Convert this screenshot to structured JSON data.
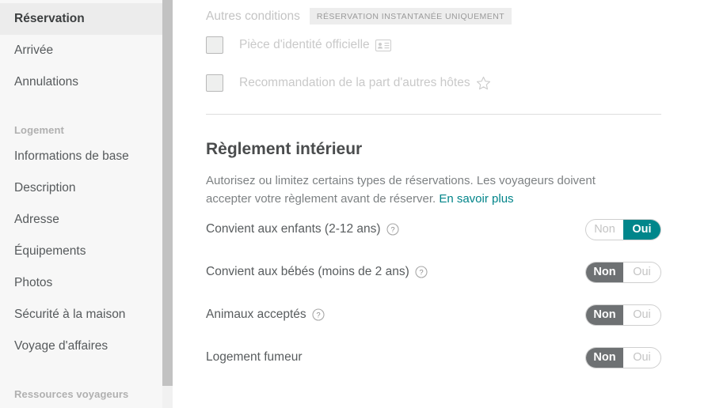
{
  "sidebar": {
    "items": [
      {
        "label": "Réservation",
        "type": "link",
        "active": true
      },
      {
        "label": "Arrivée",
        "type": "link",
        "active": false
      },
      {
        "label": "Annulations",
        "type": "link",
        "active": false
      },
      {
        "label": "Logement",
        "type": "section"
      },
      {
        "label": "Informations de base",
        "type": "link",
        "active": false
      },
      {
        "label": "Description",
        "type": "link",
        "active": false
      },
      {
        "label": "Adresse",
        "type": "link",
        "active": false
      },
      {
        "label": "Équipements",
        "type": "link",
        "active": false
      },
      {
        "label": "Photos",
        "type": "link",
        "active": false
      },
      {
        "label": "Sécurité à la maison",
        "type": "link",
        "active": false
      },
      {
        "label": "Voyage d'affaires",
        "type": "link",
        "active": false
      },
      {
        "label": "Ressources voyageurs",
        "type": "section"
      }
    ]
  },
  "other_conditions": {
    "title": "Autres conditions",
    "badge": "RÉSERVATION INSTANTANÉE UNIQUEMENT",
    "checkboxes": [
      {
        "label": "Pièce d'identité officielle",
        "icon": "id-card-icon",
        "checked": false,
        "disabled": true
      },
      {
        "label": "Recommandation de la part d'autres hôtes",
        "icon": "star-icon",
        "checked": false,
        "disabled": true
      }
    ]
  },
  "house_rules": {
    "title": "Règlement intérieur",
    "description": "Autorisez ou limitez certains types de réservations. Les voyageurs doivent accepter votre règlement avant de réserver.",
    "link_text": "En savoir plus",
    "toggle_no_label": "Non",
    "toggle_yes_label": "Oui",
    "rules": [
      {
        "label": "Convient aux enfants (2-12 ans)",
        "help": true,
        "value": "Oui"
      },
      {
        "label": "Convient aux bébés (moins de 2 ans)",
        "help": true,
        "value": "Non"
      },
      {
        "label": "Animaux acceptés",
        "help": true,
        "value": "Non"
      },
      {
        "label": "Logement fumeur",
        "help": false,
        "value": "Non"
      }
    ]
  },
  "colors": {
    "accent_teal": "#008489",
    "toggle_yes_bg": "#00868b",
    "toggle_no_bg": "#6e7173",
    "sidebar_bg": "#f7f7f7",
    "badge_bg": "#ededed"
  }
}
